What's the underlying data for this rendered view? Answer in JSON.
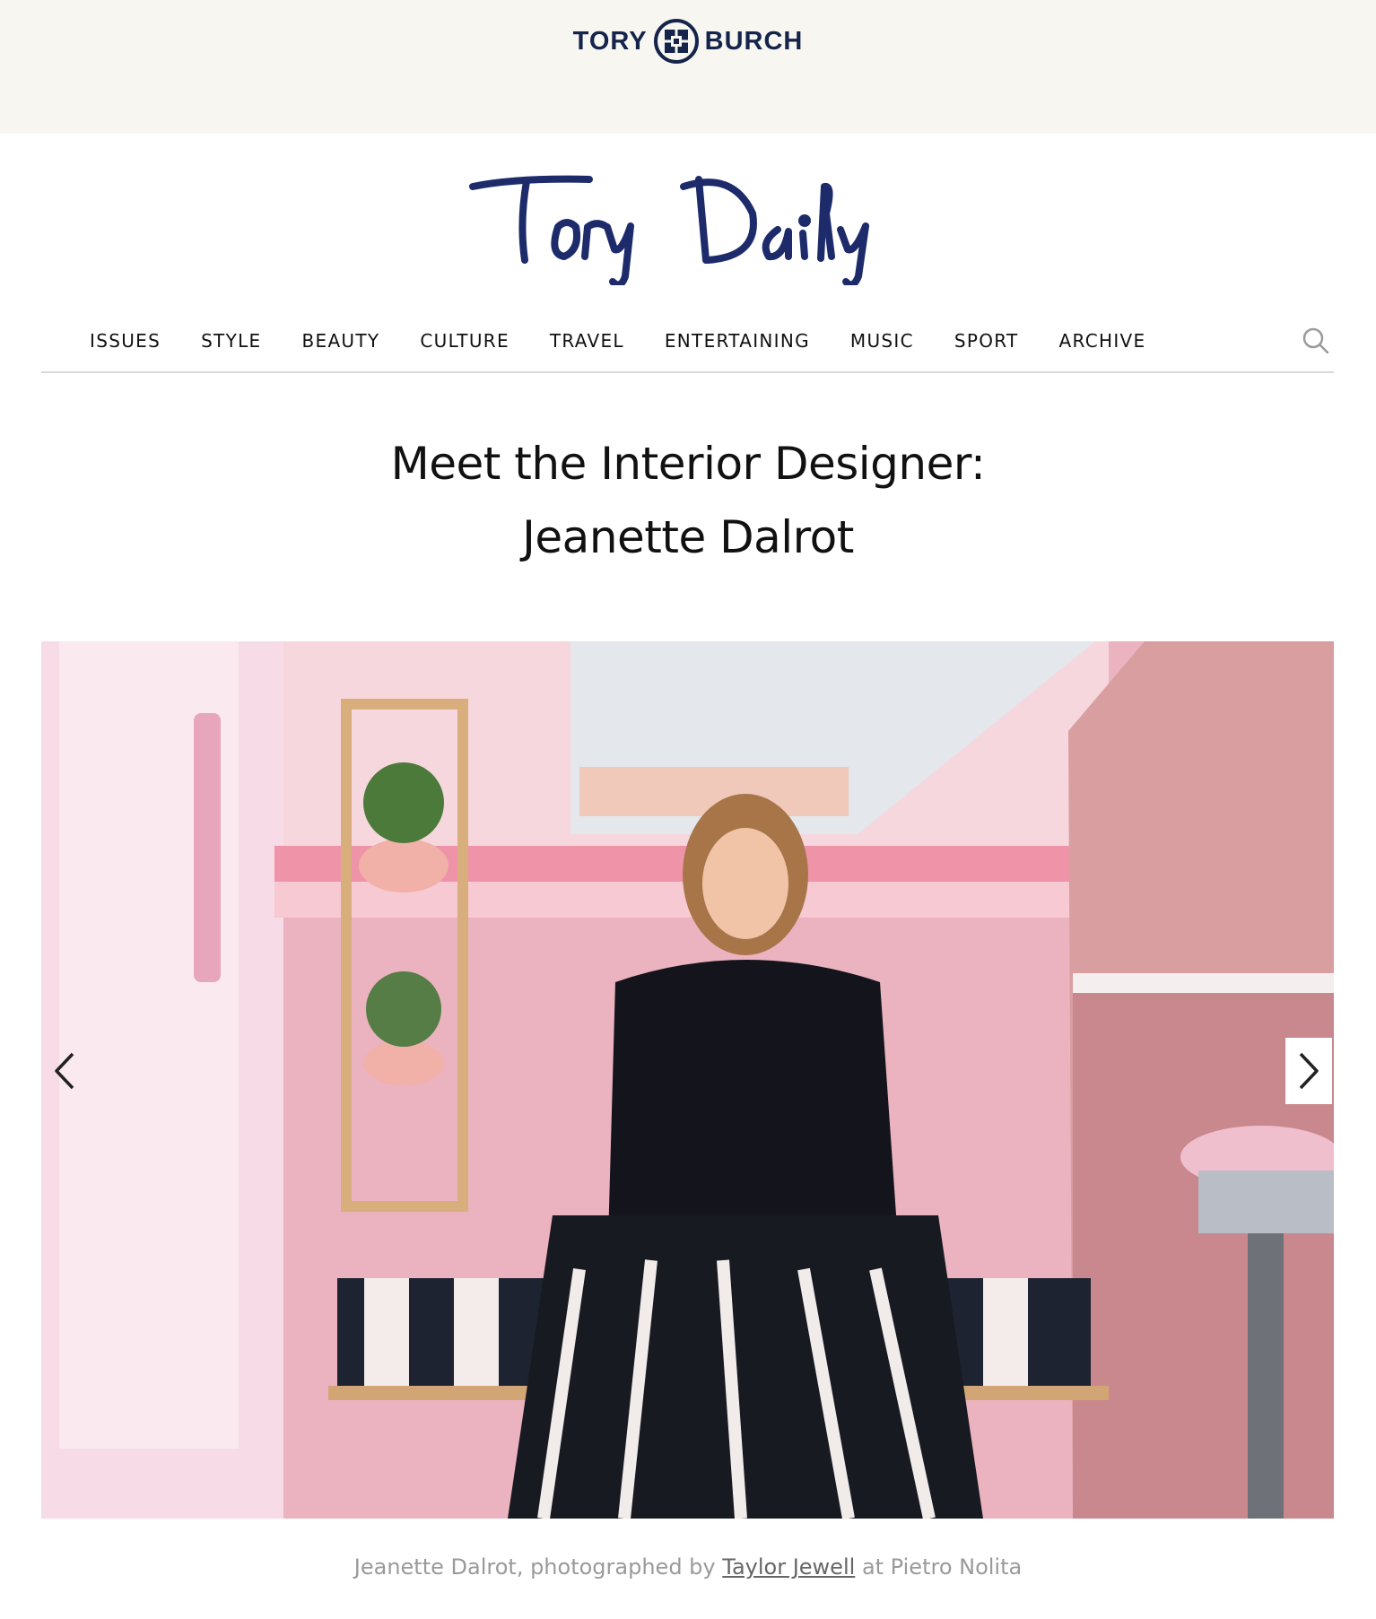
{
  "header": {
    "brand_left": "TORY",
    "brand_right": "BURCH",
    "site_logo": "Tory Daily",
    "brand_color": "#14244a"
  },
  "nav": {
    "items": [
      "ISSUES",
      "STYLE",
      "BEAUTY",
      "CULTURE",
      "TRAVEL",
      "ENTERTAINING",
      "MUSIC",
      "SPORT",
      "ARCHIVE"
    ],
    "search_icon": "search-icon"
  },
  "article": {
    "title_line1": "Meet the Interior Designer:",
    "title_line2": "Jeanette Dalrot"
  },
  "slideshow": {
    "prev_icon": "chevron-left-icon",
    "next_icon": "chevron-right-icon"
  },
  "caption": {
    "prefix": "Jeanette Dalrot, photographed by",
    "photographer": "Taylor Jewell",
    "suffix": "at Pietro Nolita"
  }
}
